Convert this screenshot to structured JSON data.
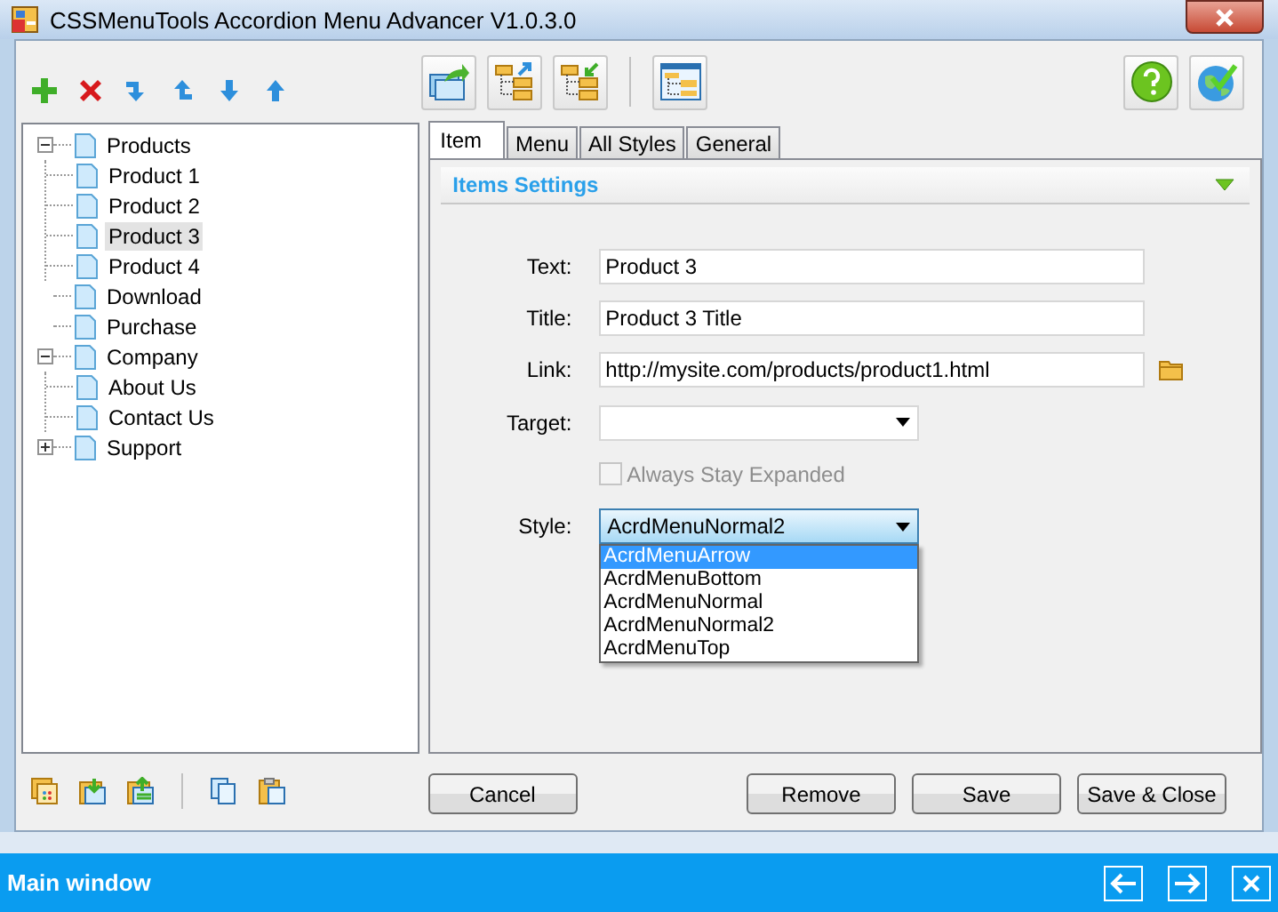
{
  "window": {
    "title": "CSSMenuTools Accordion Menu Advancer V1.0.3.0"
  },
  "tree": [
    {
      "label": "Products",
      "expanded": true,
      "selected": false,
      "children": [
        {
          "label": "Product 1",
          "selected": false
        },
        {
          "label": "Product 2",
          "selected": false
        },
        {
          "label": "Product 3",
          "selected": true
        },
        {
          "label": "Product 4",
          "selected": false
        }
      ]
    },
    {
      "label": "Download",
      "selected": false
    },
    {
      "label": "Purchase",
      "selected": false
    },
    {
      "label": "Company",
      "expanded": true,
      "selected": false,
      "children": [
        {
          "label": "About Us",
          "selected": false
        },
        {
          "label": "Contact Us",
          "selected": false
        }
      ]
    },
    {
      "label": "Support",
      "expanded": false,
      "selected": false
    }
  ],
  "tabs": [
    {
      "label": "Item",
      "selected": true
    },
    {
      "label": "Menu",
      "selected": false
    },
    {
      "label": "All Styles",
      "selected": false
    },
    {
      "label": "General",
      "selected": false
    }
  ],
  "section": {
    "title": "Items Settings",
    "expanded": true
  },
  "fields": [
    {
      "kind": "text",
      "label": "Text:",
      "value": "Product 3"
    },
    {
      "kind": "text",
      "label": "Title:",
      "value": "Product 3 Title"
    },
    {
      "kind": "link",
      "label": "Link:",
      "value": "http://mysite.com/products/product1.html"
    },
    {
      "kind": "select",
      "label": "Target:",
      "open": false
    },
    {
      "kind": "checkbox",
      "text": "Always Stay Expanded",
      "checked": false,
      "disabled": true
    },
    {
      "kind": "select",
      "label": "Style:",
      "value": "AcrdMenuNormal2",
      "open": true,
      "options": [
        {
          "label": "AcrdMenuArrow",
          "highlighted": true
        },
        {
          "label": "AcrdMenuBottom",
          "highlighted": false
        },
        {
          "label": "AcrdMenuNormal",
          "highlighted": false
        },
        {
          "label": "AcrdMenuNormal2",
          "highlighted": false
        },
        {
          "label": "AcrdMenuTop",
          "highlighted": false
        }
      ]
    }
  ],
  "buttons": [
    {
      "label": "Cancel"
    },
    {
      "label": "Remove"
    },
    {
      "label": "Save"
    },
    {
      "label": "Save & Close"
    }
  ],
  "status_bar": {
    "title": "Main window"
  }
}
